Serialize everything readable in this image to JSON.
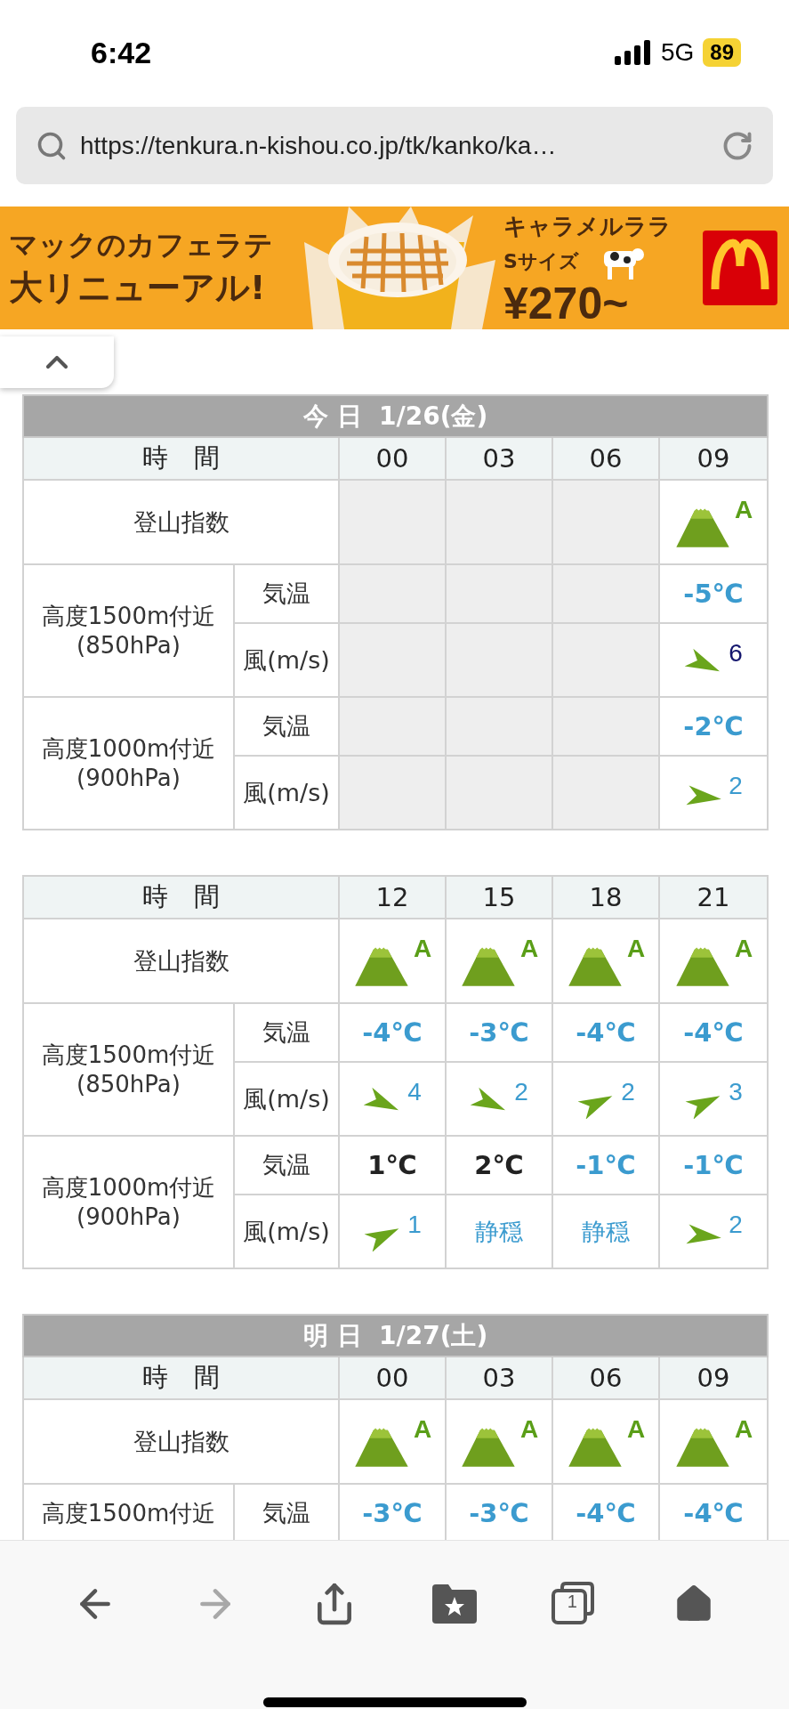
{
  "status_bar": {
    "time": "6:42",
    "network": "5G",
    "battery": "89"
  },
  "address_bar": {
    "url": "https://tenkura.n-kishou.co.jp/tk/kanko/ka…"
  },
  "ad": {
    "headline": "マックのカフェラテ",
    "headline_2": "大リニューアル!",
    "product": "キャラメルララ",
    "size": "Sサイズ",
    "price": "¥270~"
  },
  "tables": [
    {
      "title": "今 日  1/26(金)",
      "header": "時　間",
      "times": [
        "00",
        "03",
        "06",
        "09"
      ],
      "index_label": "登山指数",
      "index": [
        {
          "kind": "empty"
        },
        {
          "kind": "empty"
        },
        {
          "kind": "empty"
        },
        {
          "kind": "grade",
          "grade": "A"
        }
      ],
      "groups": [
        {
          "label": "高度1500m付近",
          "sub": "(850hPa)",
          "temp_label": "気温",
          "wind_label": "風(m/s)",
          "temps": [
            {
              "kind": "empty"
            },
            {
              "kind": "empty"
            },
            {
              "kind": "empty"
            },
            {
              "kind": "value",
              "text": "-5℃",
              "below_zero": true
            }
          ],
          "winds": [
            {
              "kind": "empty"
            },
            {
              "kind": "empty"
            },
            {
              "kind": "empty"
            },
            {
              "kind": "sinking",
              "speed": "6",
              "strong": true
            }
          ]
        },
        {
          "label": "高度1000m付近",
          "sub": "(900hPa)",
          "temp_label": "気温",
          "wind_label": "風(m/s)",
          "temps": [
            {
              "kind": "empty"
            },
            {
              "kind": "empty"
            },
            {
              "kind": "empty"
            },
            {
              "kind": "value",
              "text": "-2℃",
              "below_zero": true
            }
          ],
          "winds": [
            {
              "kind": "empty"
            },
            {
              "kind": "empty"
            },
            {
              "kind": "empty"
            },
            {
              "kind": "level",
              "speed": "2",
              "strong": false
            }
          ]
        }
      ]
    },
    {
      "header": "時　間",
      "times": [
        "12",
        "15",
        "18",
        "21"
      ],
      "index_label": "登山指数",
      "index": [
        {
          "kind": "grade",
          "grade": "A"
        },
        {
          "kind": "grade",
          "grade": "A"
        },
        {
          "kind": "grade",
          "grade": "A"
        },
        {
          "kind": "grade",
          "grade": "A"
        }
      ],
      "groups": [
        {
          "label": "高度1500m付近",
          "sub": "(850hPa)",
          "temp_label": "気温",
          "wind_label": "風(m/s)",
          "temps": [
            {
              "kind": "value",
              "text": "-4℃",
              "below_zero": true
            },
            {
              "kind": "value",
              "text": "-3℃",
              "below_zero": true
            },
            {
              "kind": "value",
              "text": "-4℃",
              "below_zero": true
            },
            {
              "kind": "value",
              "text": "-4℃",
              "below_zero": true
            }
          ],
          "winds": [
            {
              "kind": "sinking",
              "speed": "4",
              "strong": false
            },
            {
              "kind": "sinking",
              "speed": "2",
              "strong": false
            },
            {
              "kind": "rising",
              "speed": "2",
              "strong": false
            },
            {
              "kind": "rising",
              "speed": "3",
              "strong": false
            }
          ]
        },
        {
          "label": "高度1000m付近",
          "sub": "(900hPa)",
          "temp_label": "気温",
          "wind_label": "風(m/s)",
          "temps": [
            {
              "kind": "value",
              "text": "1℃",
              "below_zero": false
            },
            {
              "kind": "value",
              "text": "2℃",
              "below_zero": false
            },
            {
              "kind": "value",
              "text": "-1℃",
              "below_zero": true
            },
            {
              "kind": "value",
              "text": "-1℃",
              "below_zero": true
            }
          ],
          "winds": [
            {
              "kind": "rising",
              "speed": "1",
              "strong": false
            },
            {
              "kind": "calm",
              "text": "静穏"
            },
            {
              "kind": "calm",
              "text": "静穏"
            },
            {
              "kind": "level",
              "speed": "2",
              "strong": false
            }
          ]
        }
      ]
    },
    {
      "title": "明 日  1/27(土)",
      "header": "時　間",
      "times": [
        "00",
        "03",
        "06",
        "09"
      ],
      "index_label": "登山指数",
      "index": [
        {
          "kind": "grade",
          "grade": "A"
        },
        {
          "kind": "grade",
          "grade": "A"
        },
        {
          "kind": "grade",
          "grade": "A"
        },
        {
          "kind": "grade",
          "grade": "A"
        }
      ],
      "groups": [
        {
          "label": "高度1500m付近",
          "temp_label": "気温",
          "temps": [
            {
              "kind": "value",
              "text": "-3℃",
              "below_zero": true
            },
            {
              "kind": "value",
              "text": "-3℃",
              "below_zero": true
            },
            {
              "kind": "value",
              "text": "-4℃",
              "below_zero": true
            },
            {
              "kind": "value",
              "text": "-4℃",
              "below_zero": true
            }
          ]
        }
      ]
    }
  ],
  "toolbar": [
    {
      "kind": "back",
      "disabled": false
    },
    {
      "kind": "forward",
      "disabled": true
    },
    {
      "kind": "share",
      "disabled": false
    },
    {
      "kind": "bookmarks",
      "disabled": false
    },
    {
      "kind": "tabs",
      "count": "1",
      "disabled": false
    },
    {
      "kind": "home",
      "disabled": false
    }
  ]
}
